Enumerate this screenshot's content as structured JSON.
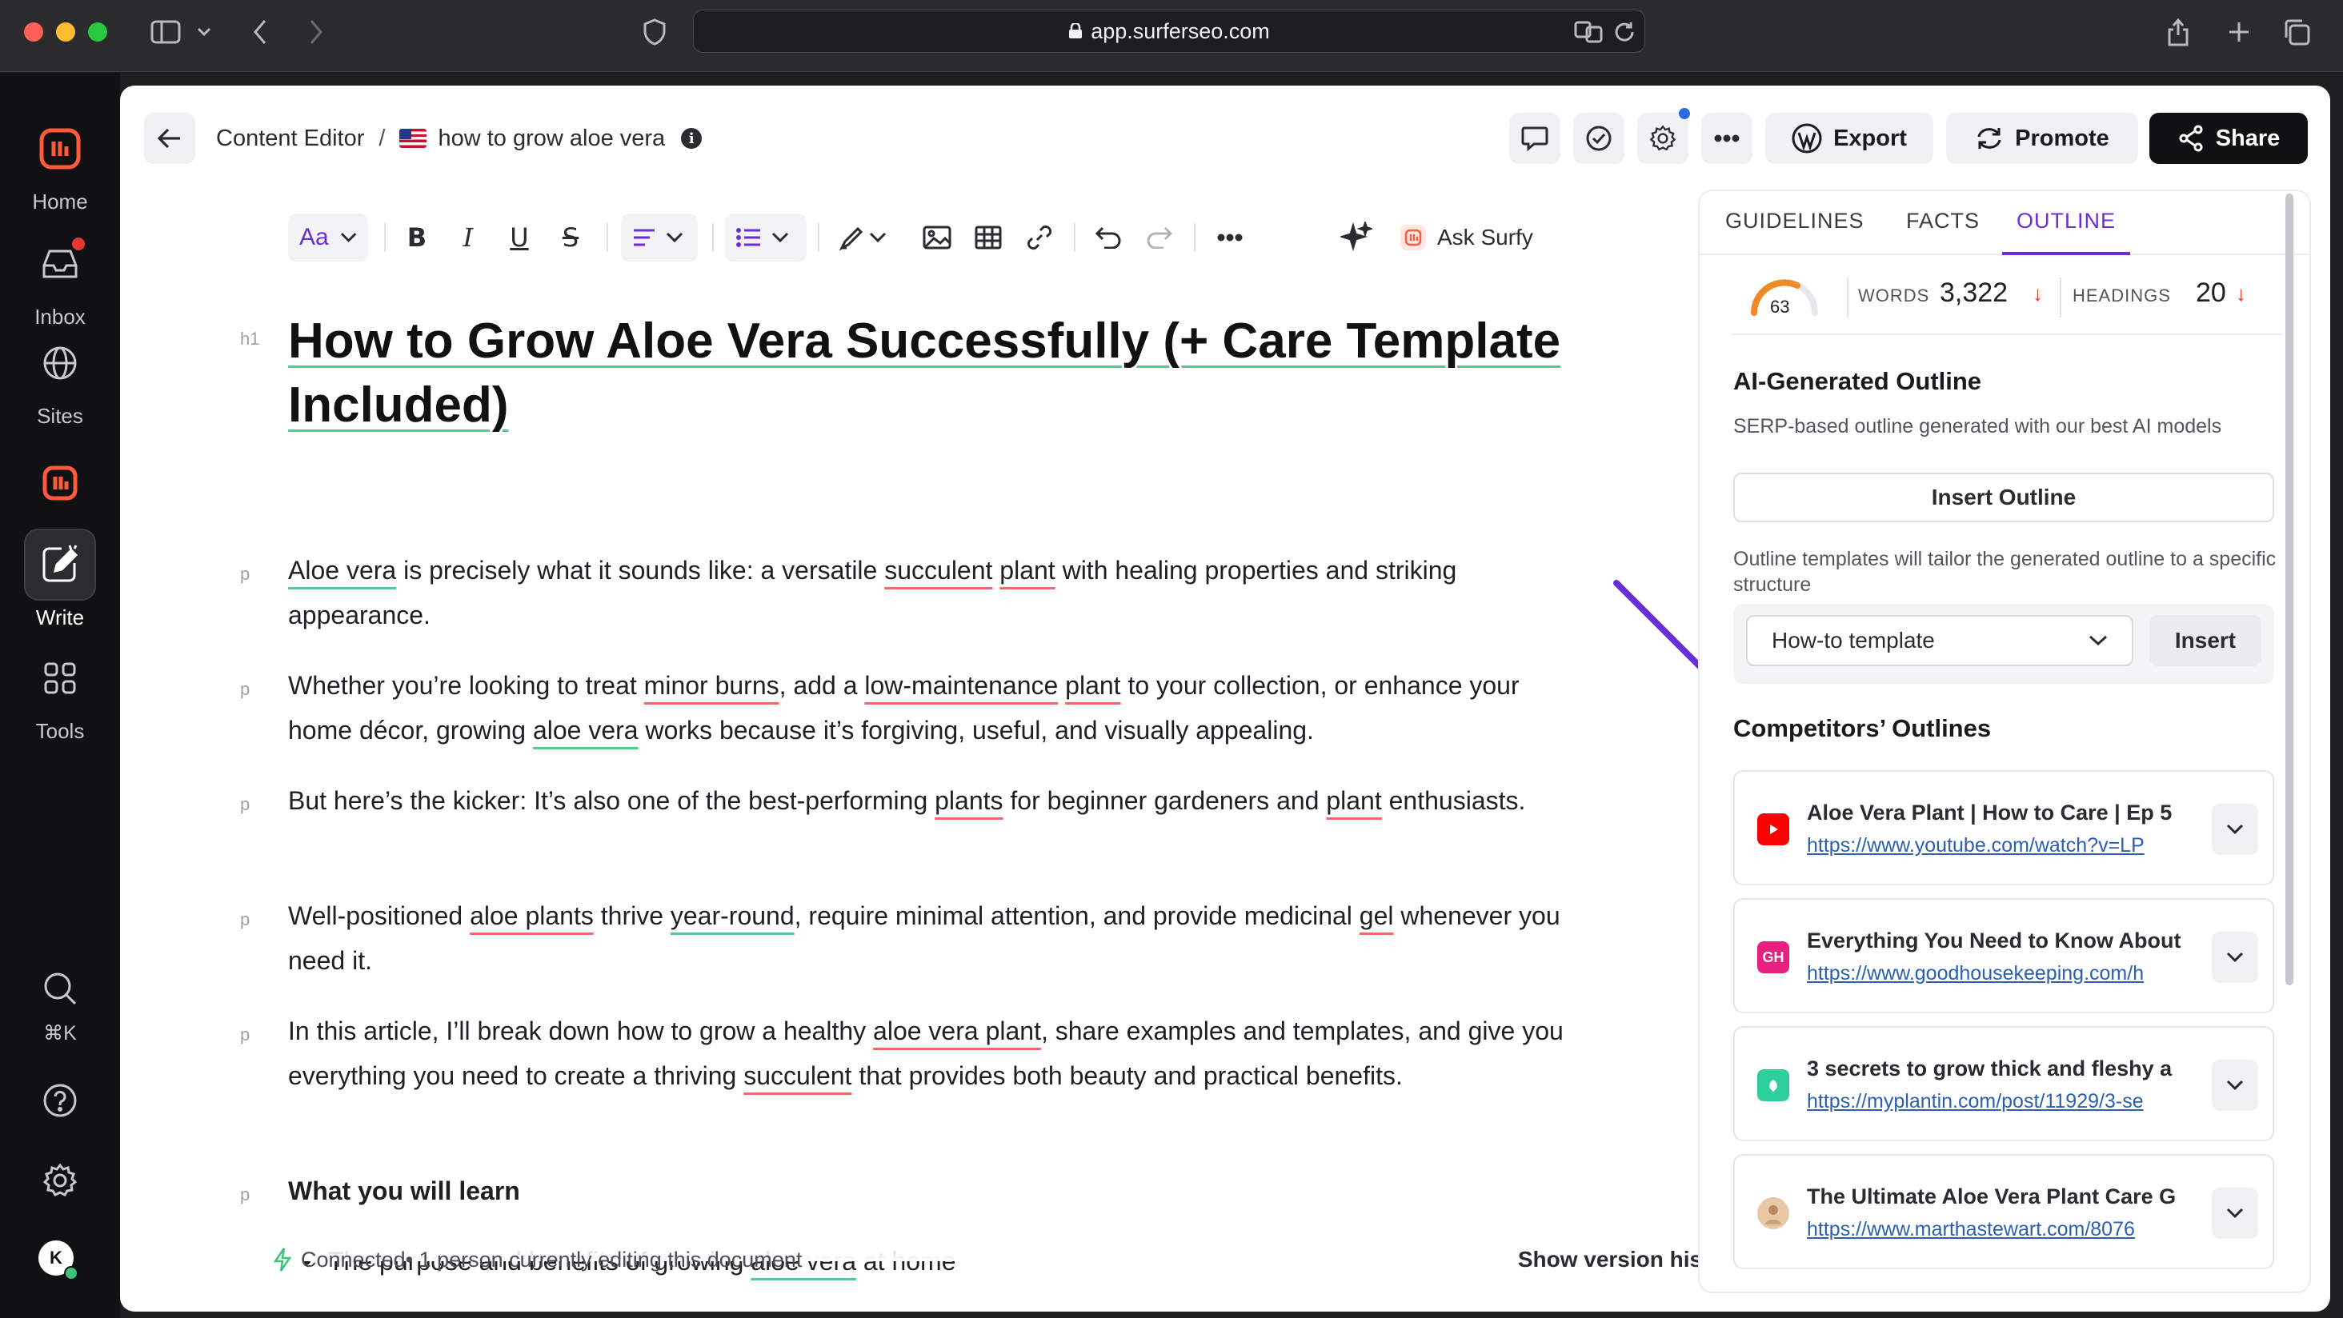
{
  "browser": {
    "url": "app.surferseo.com"
  },
  "nav": {
    "items": [
      {
        "label": "Home"
      },
      {
        "label": "Inbox"
      },
      {
        "label": "Sites"
      },
      {
        "label": "Write"
      },
      {
        "label": "Tools"
      }
    ],
    "shortcut": "⌘K",
    "avatar_letter": "K"
  },
  "header": {
    "breadcrumb_root": "Content Editor",
    "separator": "/",
    "doc_name": "how to grow aloe vera",
    "export_label": "Export",
    "promote_label": "Promote",
    "share_label": "Share"
  },
  "toolbar": {
    "font_label": "Aa",
    "ask_label": "Ask Surfy"
  },
  "document": {
    "h1_tag": "h1",
    "p_tag": "p",
    "title": "How to Grow Aloe Vera Successfully (+ Care Template Included)",
    "paragraphs": [
      {
        "a": "Aloe vera",
        "b": " is precisely what it sounds like: a versatile ",
        "c": "succulent",
        "d": " ",
        "e": "plant",
        "f": " with healing properties and striking appearance."
      },
      {
        "a": "Whether you’re looking to treat ",
        "b": "minor burns",
        "c": ", add a ",
        "d": "low-maintenance",
        "e": " ",
        "f": "plant",
        "g": " to your collection, or enhance your home décor, growing ",
        "h": "aloe vera",
        "i": " works because it’s forgiving, useful, and visually appealing."
      },
      {
        "a": "But here’s the kicker: It’s also one of the best-performing ",
        "b": "plants",
        "c": " for beginner gardeners and ",
        "d": "plant",
        "e": " enthusiasts."
      },
      {
        "a": "Well-positioned ",
        "b": "aloe plants",
        "c": " thrive ",
        "d": "year-round",
        "e": ", require minimal attention, and provide medicinal ",
        "f": "gel",
        "g": " whenever you need it."
      },
      {
        "a": "In this article, I’ll break down how to grow a healthy ",
        "b": "aloe vera plant",
        "c": ", share examples and templates, and give you everything you need to create a thriving ",
        "d": "succulent",
        "e": " that provides both beauty and practical benefits."
      }
    ],
    "learn_heading": "What you will learn",
    "bullet_1a": "The purpose and benefits of growing ",
    "bullet_1b": "aloe vera",
    "bullet_1c": " at home"
  },
  "status": {
    "connected": "Connected",
    "editing": " • 1 person currently editing this document",
    "version_history": "Show version history"
  },
  "panel": {
    "tabs": [
      {
        "label": "GUIDELINES"
      },
      {
        "label": "FACTS"
      },
      {
        "label": "OUTLINE",
        "active": true
      }
    ],
    "score": "63",
    "words_label": "WORDS",
    "words_value": "3,322",
    "headings_label": "HEADINGS",
    "headings_value": "20",
    "ai_title": "AI-Generated Outline",
    "ai_desc": "SERP-based outline generated with our best AI models",
    "insert_outline": "Insert Outline",
    "templates_desc": "Outline templates will tailor the generated outline to a specific structure",
    "template_selected": "How-to template",
    "template_insert": "Insert",
    "competitors_title": "Competitors’ Outlines",
    "competitors": [
      {
        "title": "Aloe Vera Plant | How to Care | Ep 5",
        "url": "https://www.youtube.com/watch?v=LP",
        "icon": "youtube-icon",
        "color": "#ff0000"
      },
      {
        "title": "Everything You Need to Know About",
        "url": "https://www.goodhousekeeping.com/h",
        "icon": "goodhousekeeping-icon",
        "color": "#e8217f",
        "glyph": "GH"
      },
      {
        "title": "3 secrets to grow thick and fleshy a",
        "url": "https://myplantin.com/post/11929/3-se",
        "icon": "myplantin-icon",
        "color": "#2fcf9c"
      },
      {
        "title": "The Ultimate Aloe Vera Plant Care G",
        "url": "https://www.marthastewart.com/8076",
        "icon": "marthastewart-avatar",
        "color": "#e7c9a8"
      }
    ]
  },
  "colors": {
    "accent_purple": "#6a2fd6",
    "keyword_green": "#58c98d",
    "keyword_red": "#ef6b6b",
    "gauge_orange": "#f08a24"
  }
}
